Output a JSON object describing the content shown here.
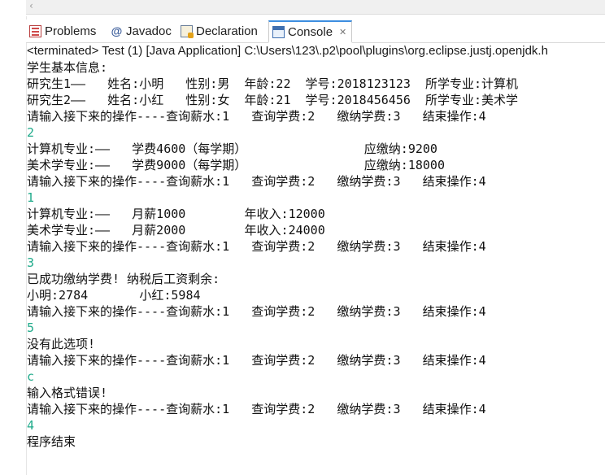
{
  "tabs": [
    {
      "label": "Problems",
      "icon": "problems-icon",
      "active": false
    },
    {
      "label": "Javadoc",
      "icon": "javadoc-icon",
      "active": false
    },
    {
      "label": "Declaration",
      "icon": "declaration-icon",
      "active": false
    },
    {
      "label": "Console",
      "icon": "console-icon",
      "active": true
    }
  ],
  "console": {
    "status": "<terminated> Test (1) [Java Application] C:\\Users\\123\\.p2\\pool\\plugins\\org.eclipse.justj.openjdk.h",
    "lines": [
      {
        "text": "学生基本信息:",
        "type": "output"
      },
      {
        "text": "研究生1——   姓名:小明   性别:男  年龄:22  学号:2018123123  所学专业:计算机",
        "type": "output"
      },
      {
        "text": "研究生2——   姓名:小红   性别:女  年龄:21  学号:2018456456  所学专业:美术学",
        "type": "output"
      },
      {
        "text": "请输入接下来的操作----查询薪水:1   查询学费:2   缴纳学费:3   结束操作:4",
        "type": "output"
      },
      {
        "text": "2",
        "type": "input"
      },
      {
        "text": "计算机专业:——   学费4600（每学期）                应缴纳:9200",
        "type": "output"
      },
      {
        "text": "美术学专业:——   学费9000（每学期）                应缴纳:18000",
        "type": "output"
      },
      {
        "text": "请输入接下来的操作----查询薪水:1   查询学费:2   缴纳学费:3   结束操作:4",
        "type": "output"
      },
      {
        "text": "1",
        "type": "input"
      },
      {
        "text": "计算机专业:——   月薪1000        年收入:12000",
        "type": "output"
      },
      {
        "text": "美术学专业:——   月薪2000        年收入:24000",
        "type": "output"
      },
      {
        "text": "请输入接下来的操作----查询薪水:1   查询学费:2   缴纳学费:3   结束操作:4",
        "type": "output"
      },
      {
        "text": "3",
        "type": "input"
      },
      {
        "text": "已成功缴纳学费! 纳税后工资剩余:",
        "type": "output"
      },
      {
        "text": "小明:2784       小红:5984",
        "type": "output"
      },
      {
        "text": "请输入接下来的操作----查询薪水:1   查询学费:2   缴纳学费:3   结束操作:4",
        "type": "output"
      },
      {
        "text": "5",
        "type": "input"
      },
      {
        "text": "没有此选项!",
        "type": "output"
      },
      {
        "text": "请输入接下来的操作----查询薪水:1   查询学费:2   缴纳学费:3   结束操作:4",
        "type": "output"
      },
      {
        "text": "c",
        "type": "input"
      },
      {
        "text": "输入格式错误!",
        "type": "output"
      },
      {
        "text": "请输入接下来的操作----查询薪水:1   查询学费:2   缴纳学费:3   结束操作:4",
        "type": "output"
      },
      {
        "text": "4",
        "type": "input"
      },
      {
        "text": "程序结束",
        "type": "output"
      }
    ]
  },
  "colors": {
    "input_text": "#1faa8a",
    "output_text": "#111111",
    "active_tab_accent": "#3d8ee0"
  }
}
